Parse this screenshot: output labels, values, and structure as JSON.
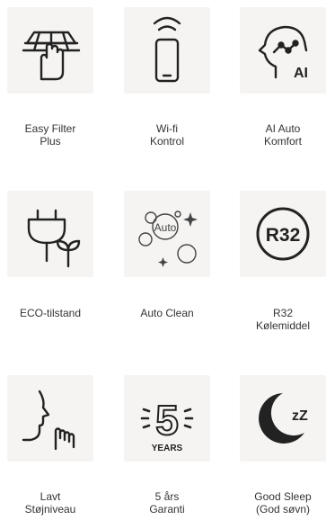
{
  "features": [
    {
      "icon": "filter-hand-icon",
      "line1": "Easy Filter",
      "line2": "Plus"
    },
    {
      "icon": "phone-wifi-icon",
      "line1": "Wi-fi",
      "line2": "Kontrol"
    },
    {
      "icon": "ai-head-icon",
      "line1": "AI Auto",
      "line2": "Komfort",
      "badge": "AI"
    },
    {
      "icon": "eco-plug-icon",
      "line1": "ECO-tilstand",
      "line2": ""
    },
    {
      "icon": "auto-clean-icon",
      "line1": "Auto Clean",
      "line2": "",
      "badge": "Auto"
    },
    {
      "icon": "r32-icon",
      "line1": "R32",
      "line2": "Kølemiddel",
      "badge": "R32"
    },
    {
      "icon": "low-noise-face-icon",
      "line1": "Lavt",
      "line2": "Støjniveau"
    },
    {
      "icon": "five-years-icon",
      "line1": "5 års",
      "line2": "Garanti",
      "badge": "5",
      "badge2": "YEARS"
    },
    {
      "icon": "moon-sleep-icon",
      "line1": "Good Sleep",
      "line2": "(God søvn)",
      "badge": "zZ"
    }
  ],
  "colors": {
    "tile": "#f5f4f2",
    "ink": "#222222",
    "text": "#333333"
  }
}
